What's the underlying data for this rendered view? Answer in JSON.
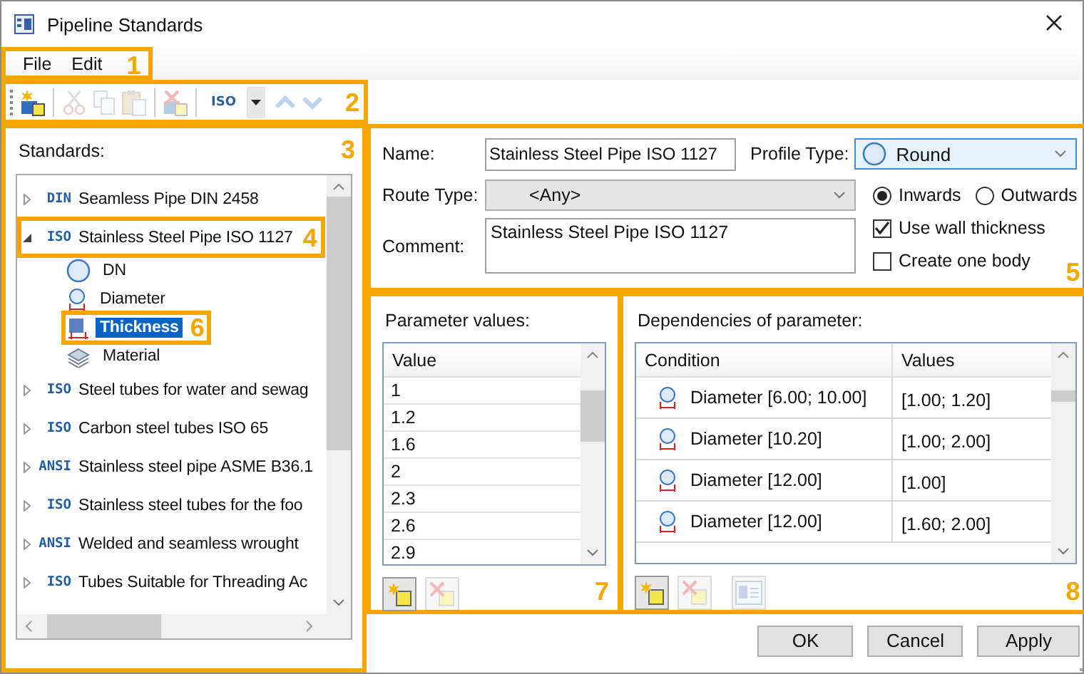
{
  "window": {
    "title": "Pipeline Standards"
  },
  "menu": {
    "items": [
      "File",
      "Edit"
    ],
    "callout": "1"
  },
  "toolbar": {
    "callout": "2",
    "groups": [
      {
        "items": [
          {
            "kind": "new",
            "disabled": false
          }
        ]
      },
      {
        "items": [
          {
            "kind": "cut",
            "disabled": true
          },
          {
            "kind": "copy",
            "disabled": true
          },
          {
            "kind": "paste",
            "disabled": true
          }
        ]
      },
      {
        "items": [
          {
            "kind": "delete",
            "disabled": true
          }
        ]
      },
      {
        "items": [
          {
            "kind": "combo",
            "value": "ISO"
          },
          {
            "kind": "up",
            "disabled": true
          },
          {
            "kind": "down",
            "disabled": true
          }
        ]
      }
    ]
  },
  "standards": {
    "label": "Standards:",
    "callout": "3",
    "items": [
      {
        "tag": "DIN",
        "label": "Seamless Pipe DIN 2458",
        "expanded": false,
        "selected": false
      },
      {
        "tag": "ISO",
        "label": "Stainless Steel Pipe ISO 1127",
        "expanded": true,
        "selected": false,
        "callout": "4",
        "children": [
          {
            "kind": "dn",
            "label": "DN",
            "selected": false
          },
          {
            "kind": "diameter",
            "label": "Diameter",
            "selected": false
          },
          {
            "kind": "thickness",
            "label": "Thickness",
            "selected": true,
            "callout": "6"
          },
          {
            "kind": "material",
            "label": "Material",
            "selected": false
          }
        ]
      },
      {
        "tag": "ISO",
        "label": "Steel tubes for water and sewag",
        "expanded": false,
        "selected": false
      },
      {
        "tag": "ISO",
        "label": "Carbon steel tubes ISO 65",
        "expanded": false,
        "selected": false
      },
      {
        "tag": "ANSI",
        "label": "Stainless steel pipe ASME B36.1",
        "expanded": false,
        "selected": false
      },
      {
        "tag": "ISO",
        "label": "Stainless steel tubes for the foo",
        "expanded": false,
        "selected": false
      },
      {
        "tag": "ANSI",
        "label": "Welded and seamless wrought",
        "expanded": false,
        "selected": false
      },
      {
        "tag": "ISO",
        "label": "Tubes Suitable for Threading Ac",
        "expanded": false,
        "selected": false
      }
    ]
  },
  "details": {
    "callout": "5",
    "name": {
      "label": "Name:",
      "value": "Stainless Steel Pipe ISO 1127"
    },
    "profile_type": {
      "label": "Profile Type:",
      "value": "Round"
    },
    "route_type": {
      "label": "Route Type:",
      "value": "<Any>"
    },
    "comment": {
      "label": "Comment:",
      "value": "Stainless Steel Pipe ISO 1127"
    },
    "direction": [
      {
        "label": "Inwards",
        "selected": true
      },
      {
        "label": "Outwards",
        "selected": false
      }
    ],
    "options": [
      {
        "label": "Use wall thickness",
        "checked": true
      },
      {
        "label": "Create one body",
        "checked": false
      }
    ]
  },
  "parameter_values": {
    "label": "Parameter values:",
    "callout": "7",
    "column": "Value",
    "rows": [
      "1",
      "1.2",
      "1.6",
      "2",
      "2.3",
      "2.6",
      "2.9"
    ],
    "buttons": [
      {
        "kind": "add",
        "disabled": false
      },
      {
        "kind": "delete",
        "disabled": true
      }
    ]
  },
  "dependencies": {
    "label": "Dependencies of parameter:",
    "callout": "8",
    "columns": [
      "Condition",
      "Values"
    ],
    "rows": [
      {
        "condition": "Diameter [6.00; 10.00]",
        "values": "[1.00; 1.20]"
      },
      {
        "condition": "Diameter [10.20]",
        "values": "[1.00; 2.00]"
      },
      {
        "condition": "Diameter [12.00]",
        "values": "[1.00]"
      },
      {
        "condition": "Diameter [12.00]",
        "values": "[1.60; 2.00]"
      }
    ],
    "buttons": [
      {
        "kind": "add",
        "disabled": false
      },
      {
        "kind": "delete",
        "disabled": true
      },
      {
        "kind": "properties",
        "disabled": true
      }
    ]
  },
  "buttons": [
    "OK",
    "Cancel",
    "Apply"
  ]
}
